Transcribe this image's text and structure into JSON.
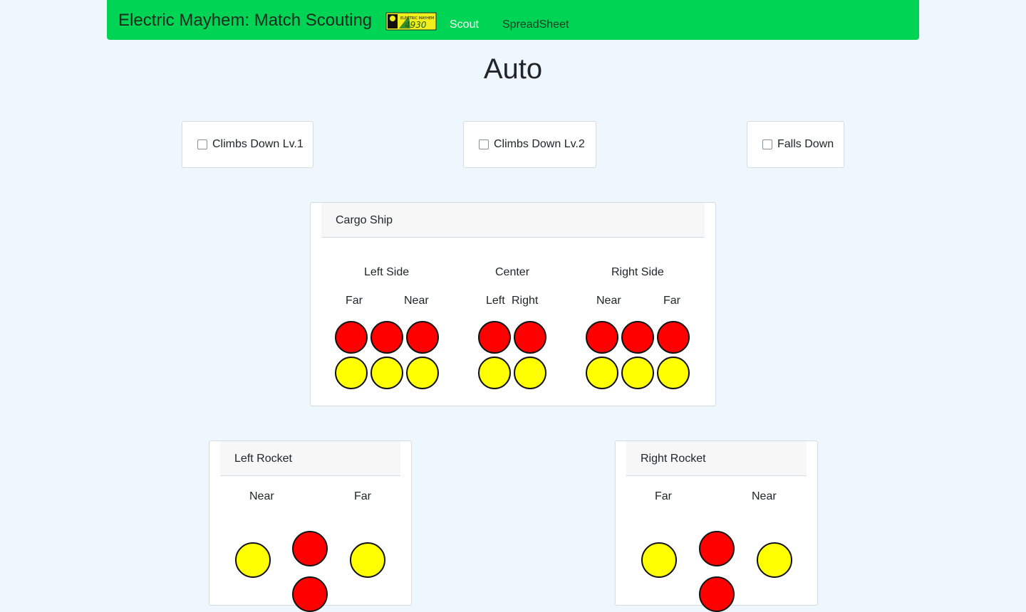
{
  "header": {
    "title": "Electric Mayhem: Match Scouting",
    "logo_text": "ELECTRIC MAYHEM",
    "logo_number": "4930",
    "nav": [
      {
        "label": "Scout"
      },
      {
        "label": "SpreadSheet"
      }
    ]
  },
  "page": {
    "title": "Auto"
  },
  "checks": [
    {
      "label": "Climbs Down Lv.1",
      "checked": false
    },
    {
      "label": "Climbs Down Lv.2",
      "checked": false
    },
    {
      "label": "Falls Down",
      "checked": false
    }
  ],
  "cargo_ship": {
    "title": "Cargo Ship",
    "sections": [
      {
        "label": "Left Side",
        "sub": [
          "Far",
          "Near"
        ]
      },
      {
        "label": "Center",
        "sub": [
          "Left",
          "Right"
        ]
      },
      {
        "label": "Right Side",
        "sub": [
          "Near",
          "Far"
        ]
      }
    ]
  },
  "left_rocket": {
    "title": "Left Rocket",
    "sub": [
      "Near",
      "Far"
    ]
  },
  "right_rocket": {
    "title": "Right Rocket",
    "sub": [
      "Far",
      "Near"
    ]
  },
  "colors": {
    "navbar": "#00d455",
    "background": "#eef6fe",
    "hatch": "#ffff00",
    "cargo": "#ff0000"
  }
}
